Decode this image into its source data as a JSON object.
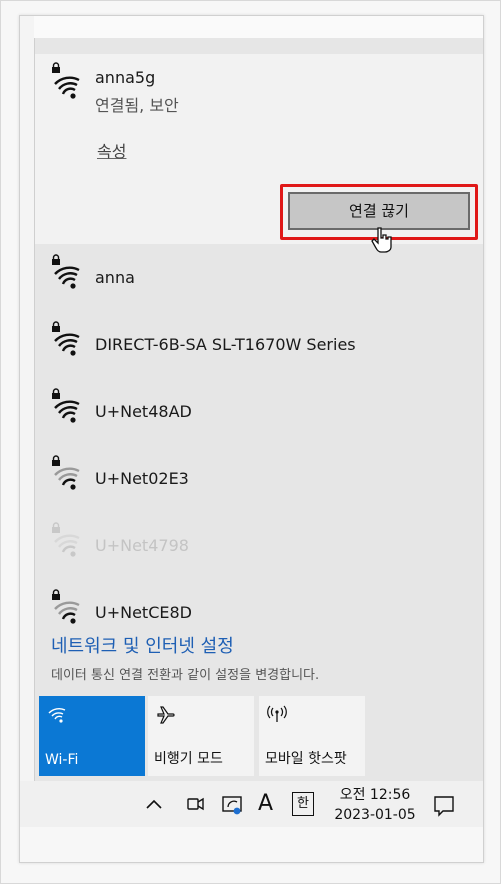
{
  "connected_network": {
    "name": "anna5g",
    "status": "연결됨, 보안",
    "properties_label": "속성",
    "disconnect_label": "연결 끊기"
  },
  "networks": [
    {
      "name": "anna",
      "dim": false
    },
    {
      "name": "DIRECT-6B-SA SL-T1670W Series",
      "dim": false
    },
    {
      "name": "U+Net48AD",
      "dim": false
    },
    {
      "name": "U+Net02E3",
      "dim": false
    },
    {
      "name": "U+Net4798",
      "dim": true
    },
    {
      "name": "U+NetCE8D",
      "dim": false
    }
  ],
  "settings": {
    "link_label": "네트워크 및 인터넷 설정",
    "description": "데이터 통신 연결 전환과 같이 설정을 변경합니다."
  },
  "quick_actions": [
    {
      "label": "Wi-Fi",
      "icon": "wifi-icon",
      "active": true
    },
    {
      "label": "비행기 모드",
      "icon": "airplane-icon",
      "active": false
    },
    {
      "label": "모바일 핫스팟",
      "icon": "hotspot-icon",
      "active": false
    }
  ],
  "taskbar": {
    "ime_mode": "A",
    "ime_lang": "한",
    "time": "오전 12:56",
    "date": "2023-01-05"
  },
  "colors": {
    "accent": "#0b78d4",
    "link": "#1e5fb4",
    "highlight_outline": "#e01818"
  }
}
